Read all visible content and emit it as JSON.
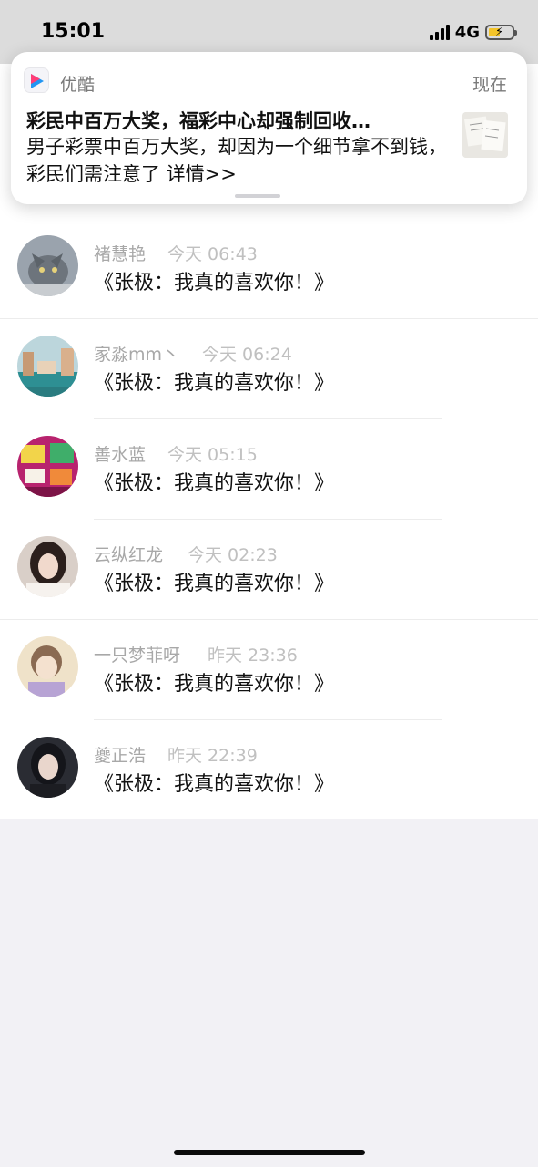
{
  "status_bar": {
    "time": "15:01",
    "network": "4G"
  },
  "notification": {
    "app_name": "优酷",
    "time": "现在",
    "title": "彩民中百万大奖，福彩中心却强制回收…",
    "body": "男子彩票中百万大奖，却因为一个细节拿不到钱，彩民们需注意了 详情>>"
  },
  "messages": [
    {
      "name": "褚慧艳",
      "time": "今天 06:43",
      "text": "《张极：我真的喜欢你！》"
    },
    {
      "name": "家淼mm丶",
      "time": "今天 06:24",
      "text": "《张极：我真的喜欢你！》"
    },
    {
      "name": "善水蓝",
      "time": "今天 05:15",
      "text": "《张极：我真的喜欢你！》"
    },
    {
      "name": "云纵红龙",
      "time": "今天 02:23",
      "text": "《张极：我真的喜欢你！》"
    },
    {
      "name": "一只梦菲呀",
      "time": "昨天 23:36",
      "text": "《张极：我真的喜欢你！》"
    },
    {
      "name": "夔正浩",
      "time": "昨天 22:39",
      "text": "《张极：我真的喜欢你！》"
    }
  ],
  "colors": {
    "battery_fill": "#f4c428",
    "muted_text": "#a8a8a8"
  }
}
